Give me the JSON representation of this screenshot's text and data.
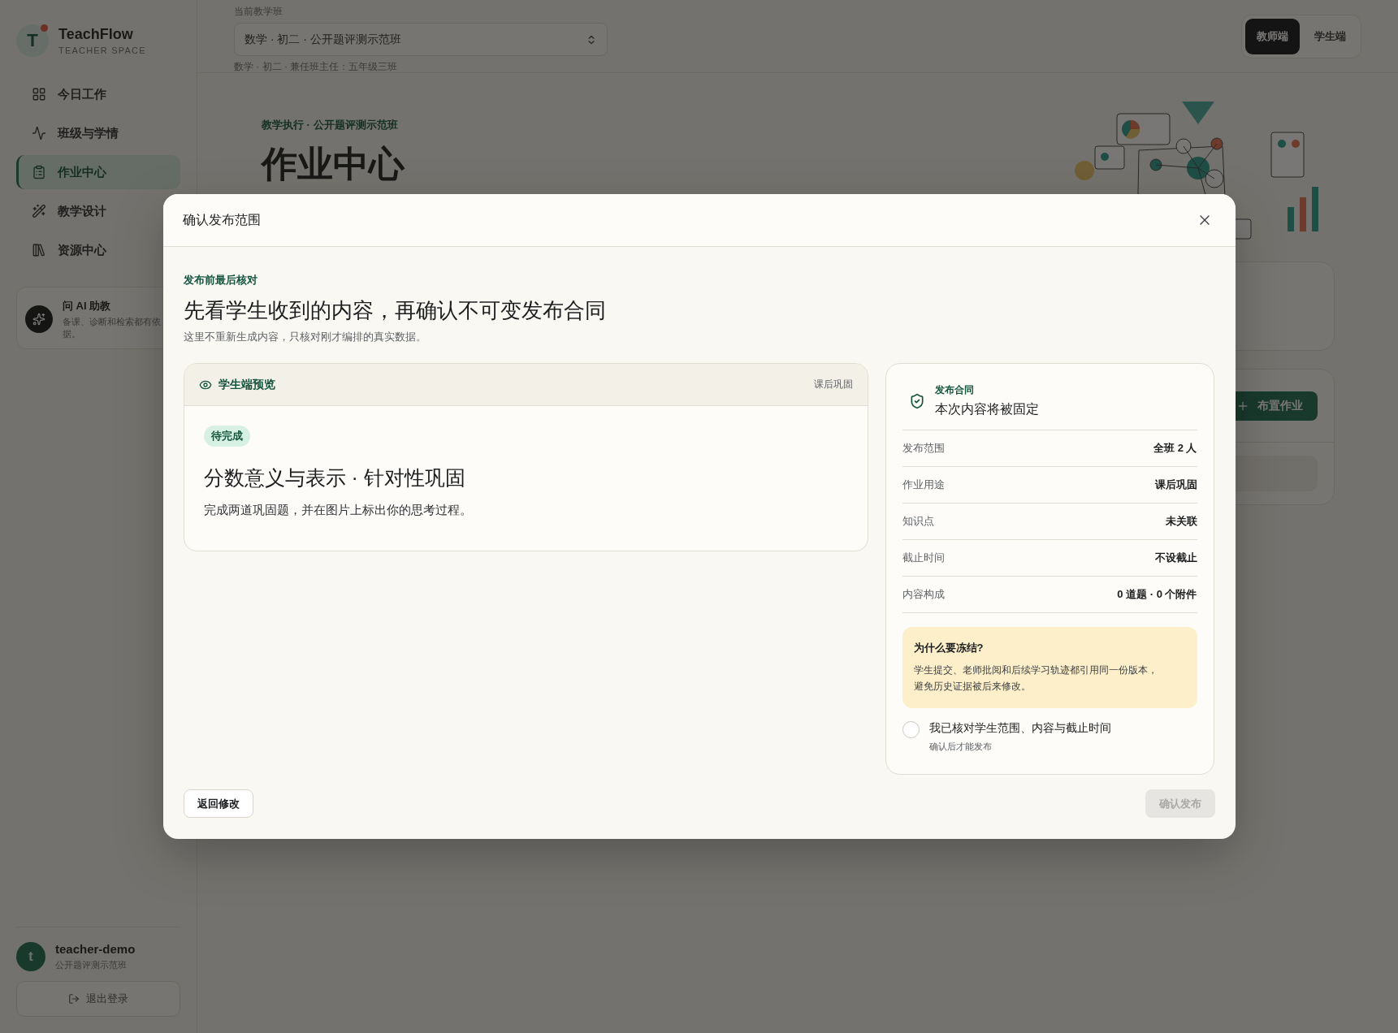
{
  "sidebar": {
    "brand": {
      "logo_letter": "T",
      "name": "TeachFlow",
      "subtitle": "TEACHER SPACE"
    },
    "nav": [
      {
        "label": "今日工作",
        "selected": false
      },
      {
        "label": "班级与学情",
        "selected": false
      },
      {
        "label": "作业中心",
        "selected": true
      },
      {
        "label": "教学设计",
        "selected": false
      },
      {
        "label": "资源中心",
        "selected": false
      }
    ],
    "ai_card": {
      "title": "问 AI 助教",
      "text": "备课、诊断和检索都有依据。"
    },
    "user": {
      "avatar_letter": "t",
      "name": "teacher-demo",
      "class": "公开题评测示范班"
    },
    "logout": "退出登录"
  },
  "header": {
    "class_label": "当前教学班",
    "class_select": "数学 · 初二 · 公开题评测示范班",
    "class_note": "数学 · 初二 · 兼任班主任：五年级三班",
    "mode_toggle": [
      {
        "label": "教师端",
        "selected": true
      },
      {
        "label": "学生端",
        "selected": false
      }
    ]
  },
  "page": {
    "eyebrow": "教学执行 · 公开题评测示范班",
    "title": "作业中心",
    "assign_button": "布置作业"
  },
  "dialog": {
    "title": "确认发布范围",
    "eyebrow": "发布前最后核对",
    "heading": "先看学生收到的内容，再确认不可变发布合同",
    "subtitle": "这里不重新生成内容，只核对刚才编排的真实数据。",
    "preview": {
      "label": "学生端预览",
      "tag": "课后巩固",
      "status": "待完成",
      "title": "分数意义与表示 · 针对性巩固",
      "description": "完成两道巩固题，并在图片上标出你的思考过程。"
    },
    "contract": {
      "eyebrow": "发布合同",
      "title": "本次内容将被固定",
      "rows": [
        {
          "label": "发布范围",
          "value": "全班 2 人"
        },
        {
          "label": "作业用途",
          "value": "课后巩固"
        },
        {
          "label": "知识点",
          "value": "未关联"
        },
        {
          "label": "截止时间",
          "value": "不设截止"
        },
        {
          "label": "内容构成",
          "value": "0 道题 · 0 个附件"
        }
      ],
      "notice": {
        "title": "为什么要冻结?",
        "text": "学生提交、老师批阅和后续学习轨迹都引用同一份版本，避免历史证据被后来修改。"
      },
      "confirm_check": {
        "label": "我已核对学生范围、内容与截止时间",
        "hint": "确认后才能发布",
        "checked": false
      }
    },
    "back_button": "返回修改",
    "confirm_button": {
      "label": "确认发布",
      "disabled": true
    }
  }
}
